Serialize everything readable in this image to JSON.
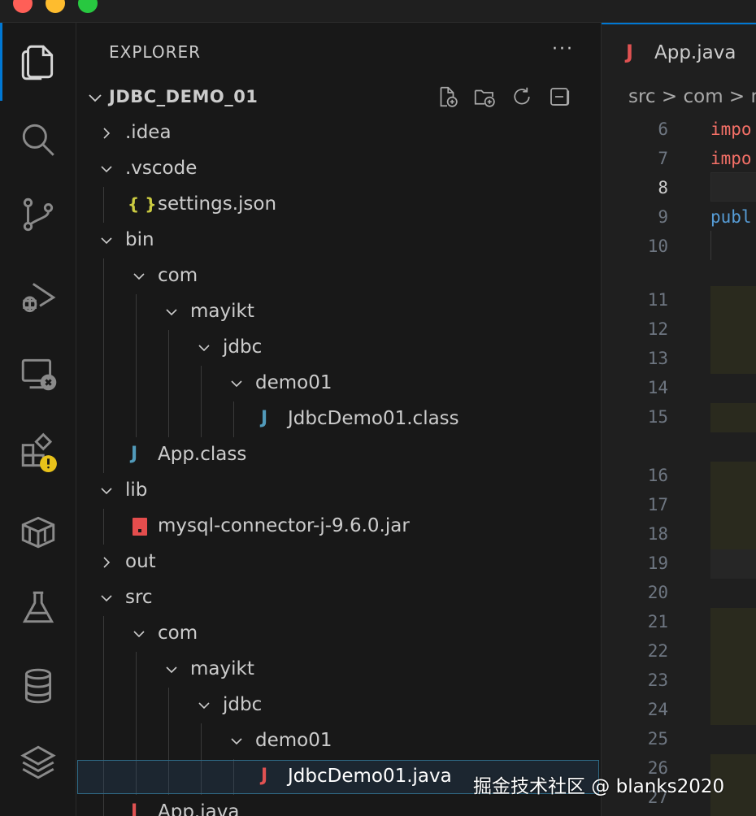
{
  "colors": {
    "accent": "#0078d4",
    "java_icon": "#e05252",
    "json_icon": "#cbcb41",
    "jar_icon": "#e44d4d",
    "warning": "#e8c21a"
  },
  "activity_bar": {
    "icons": [
      "explorer-icon",
      "search-icon",
      "source-control-icon",
      "run-debug-icon",
      "remote-explorer-icon",
      "extensions-icon",
      "java-projects-icon",
      "testing-icon",
      "database-icon",
      "layers-icon"
    ]
  },
  "explorer": {
    "title": "EXPLORER",
    "more": "···",
    "root": "JDBC_DEMO_01",
    "items": [
      {
        "label": ".idea",
        "icon": ""
      },
      {
        "label": ".vscode",
        "icon": ""
      },
      {
        "label": "settings.json",
        "icon": "{ }"
      },
      {
        "label": "bin",
        "icon": ""
      },
      {
        "label": "com",
        "icon": ""
      },
      {
        "label": "mayikt",
        "icon": ""
      },
      {
        "label": "jdbc",
        "icon": ""
      },
      {
        "label": "demo01",
        "icon": ""
      },
      {
        "label": "JdbcDemo01.class",
        "icon": "J"
      },
      {
        "label": "App.class",
        "icon": "J"
      },
      {
        "label": "lib",
        "icon": ""
      },
      {
        "label": "mysql-connector-j-9.6.0.jar",
        "icon": ""
      },
      {
        "label": "out",
        "icon": ""
      },
      {
        "label": "src",
        "icon": ""
      },
      {
        "label": "com",
        "icon": ""
      },
      {
        "label": "mayikt",
        "icon": ""
      },
      {
        "label": "jdbc",
        "icon": ""
      },
      {
        "label": "demo01",
        "icon": ""
      },
      {
        "label": "JdbcDemo01.java",
        "icon": "J"
      },
      {
        "label": "App.java",
        "icon": "J"
      }
    ]
  },
  "editor": {
    "tab_label": "App.java",
    "tab_icon": "J",
    "breadcrumb": "src > com > m",
    "line_numbers": [
      "6",
      "7",
      "8",
      "9",
      "10",
      "11",
      "12",
      "13",
      "14",
      "15",
      "16",
      "17",
      "18",
      "19",
      "20",
      "21",
      "22",
      "23",
      "24",
      "25",
      "26",
      "27"
    ],
    "code": {
      "line6": "impo",
      "line7": "impo",
      "line9": "publ"
    }
  },
  "watermark": "掘金技术社区 @ blanks2020"
}
